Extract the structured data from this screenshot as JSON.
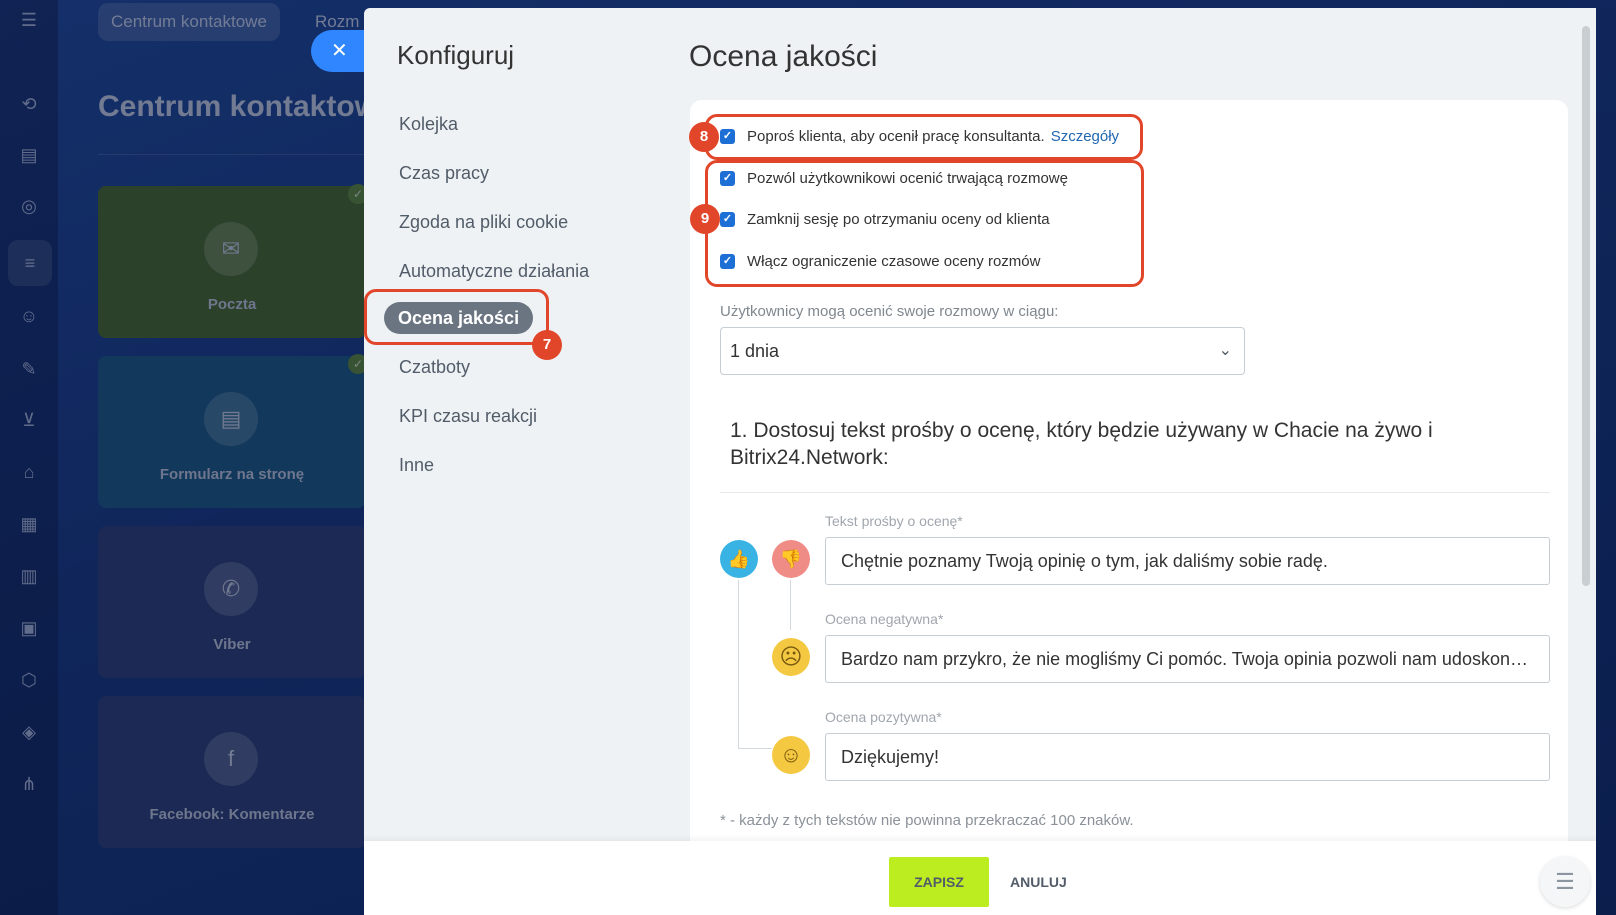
{
  "background": {
    "tabs": [
      "Centrum kontaktowe",
      "Rozm"
    ],
    "title": "Centrum kontaktow",
    "cards": [
      {
        "label": "Poczta",
        "color": "#4a6b2a"
      },
      {
        "label": "Formularz na stronę",
        "color": "#1a5a88"
      },
      {
        "label": "Viber",
        "color": "#2a3f78"
      },
      {
        "label": "Facebook: Komentarze",
        "color": "#2a3f78"
      }
    ],
    "rail_icons": [
      "menu-icon",
      "workflow-icon",
      "contacts-icon",
      "target-icon",
      "filter-icon",
      "robot-icon",
      "pen-icon",
      "cart-icon",
      "store-icon",
      "calendar-icon",
      "chart-icon",
      "doc-edit-icon",
      "hexagon-icon",
      "box-icon",
      "sitemap-icon"
    ]
  },
  "close_icon": "✕",
  "menu": {
    "title": "Konfiguruj",
    "items": [
      "Kolejka",
      "Czas pracy",
      "Zgoda na pliki cookie",
      "Automatyczne działania",
      "Ocena jakości",
      "Czatboty",
      "KPI czasu reakcji",
      "Inne"
    ],
    "active_index": 4
  },
  "content": {
    "title": "Ocena jakości",
    "checkboxes": [
      {
        "label": "Poproś klienta, aby ocenił pracę konsultanta.",
        "link": "Szczegóły",
        "checked": true
      },
      {
        "label": "Pozwól użytkownikowi ocenić trwającą rozmowę",
        "checked": true
      },
      {
        "label": "Zamknij sesję po otrzymaniu oceny od klienta",
        "checked": true
      },
      {
        "label": "Włącz ograniczenie czasowe oceny rozmów",
        "checked": true
      }
    ],
    "period_label": "Użytkownicy mogą ocenić swoje rozmowy w ciągu:",
    "period_value": "1 dnia",
    "section_heading": "1. Dostosuj tekst prośby o ocenę, który będzie używany w Chacie na żywo i Bitrix24.Network:",
    "fields": [
      {
        "label": "Tekst prośby o ocenę*",
        "value": "Chętnie poznamy Twoją opinię o tym, jak daliśmy sobie radę."
      },
      {
        "label": "Ocena negatywna*",
        "value": "Bardzo nam przykro, że nie mogliśmy Ci pomóc. Twoja opinia pozwoli nam udoskonalić nasze usługi."
      },
      {
        "label": "Ocena pozytywna*",
        "value": "Dziękujemy!"
      }
    ],
    "footnote": "* - każdy z tych tekstów nie powinna przekraczać 100 znaków."
  },
  "footer": {
    "save": "ZAPISZ",
    "cancel": "ANULUJ"
  },
  "annotations": [
    "8",
    "9",
    "7"
  ],
  "colors": {
    "accent": "#2f86ff",
    "highlight": "#e2462a",
    "save": "#bbed21"
  }
}
